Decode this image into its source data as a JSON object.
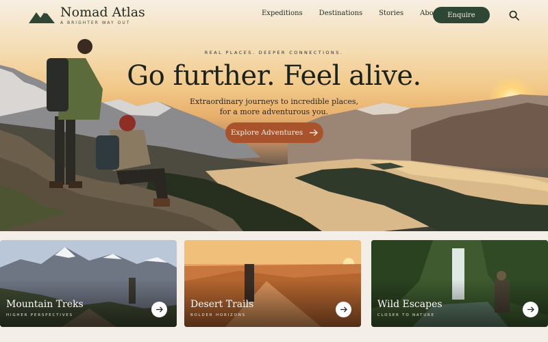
{
  "brand": {
    "name": "Nomad Atlas",
    "tagline": "A BRIGHTER WAY OUT",
    "colors": {
      "primary": "#2e4634",
      "accent": "#a9532d",
      "text": "#1f2a22"
    }
  },
  "nav": {
    "links": [
      "Expeditions",
      "Destinations",
      "Stories",
      "About"
    ],
    "cta_label": "Enquire",
    "search_icon": "search-icon"
  },
  "hero": {
    "kicker": "REAL PLACES. DEEPER CONNECTIONS.",
    "headline": "Go further. Feel alive.",
    "subhead_line1": "Extraordinary journeys to incredible places,",
    "subhead_line2": "for a more adventurous you.",
    "cta_label": "Explore Adventures",
    "cta_icon": "arrow-right-icon"
  },
  "cards": [
    {
      "title": "Mountain Treks",
      "subtitle": "HIGHER PERSPECTIVES",
      "icon": "arrow-right-icon"
    },
    {
      "title": "Desert Trails",
      "subtitle": "BOLDER HORIZONS",
      "icon": "arrow-right-icon"
    },
    {
      "title": "Wild Escapes",
      "subtitle": "CLOSER TO NATURE",
      "icon": "arrow-right-icon"
    }
  ]
}
